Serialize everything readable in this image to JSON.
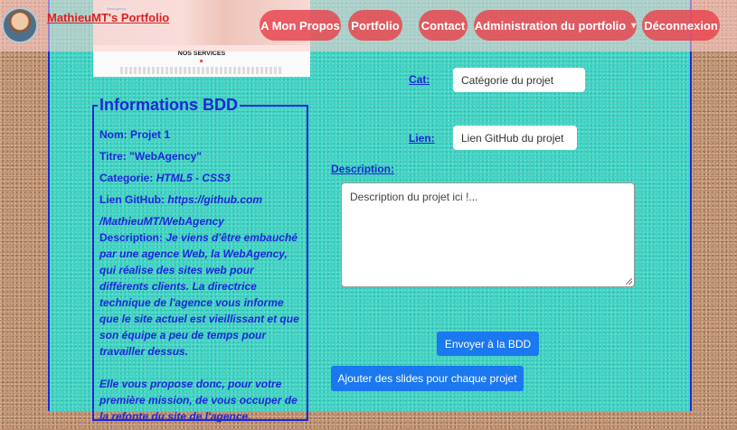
{
  "navbar": {
    "brand": "MathieuMT's Portfolio",
    "items": [
      "A Mon Propos",
      "Portfolio",
      "Contact",
      "Administration du portfolio",
      "Déconnexion"
    ],
    "dropdown_caret": "▾"
  },
  "preview": {
    "section_title": "NOS SERVICES",
    "tag_text": "WebAgency"
  },
  "info_box": {
    "legend": "Informations BDD",
    "nom_label": "Nom:",
    "nom_value": "Projet 1",
    "titre_label": "Titre:",
    "titre_value": "\"WebAgency\"",
    "categorie_label": "Categorie:",
    "categorie_value": "HTML5 - CSS3",
    "github_label": "Lien GitHub:",
    "github_value_1": "https://github.com",
    "github_value_2": "/MathieuMT/WebAgency",
    "description_label": "Description:",
    "description_value": "Je viens d'être embauché par une agence Web, la WebAgency, qui réalise des sites web pour différents clients. La directrice technique de l'agence vous informe que le site actuel est vieillissant et que son équipe a peu de temps pour travailler dessus.",
    "description_value_2": "Elle vous propose donc, pour votre première mission, de vous occuper de la refonte du site de l'agence."
  },
  "form": {
    "cat_label": "Cat:",
    "cat_placeholder": "Catégorie du projet",
    "lien_label": "Lien:",
    "lien_placeholder": "Lien GitHub du projet",
    "description_label": "Description:",
    "description_placeholder": "Description du projet ici !...",
    "submit_label": "Envoyer à la BDD",
    "slides_label": "Ajouter des slides pour chaque projet"
  },
  "colors": {
    "accent_blue": "#1e28d8",
    "button_blue": "#1a78f0",
    "nav_pill": "#e84650",
    "panel_teal": "#3ed3c3"
  }
}
